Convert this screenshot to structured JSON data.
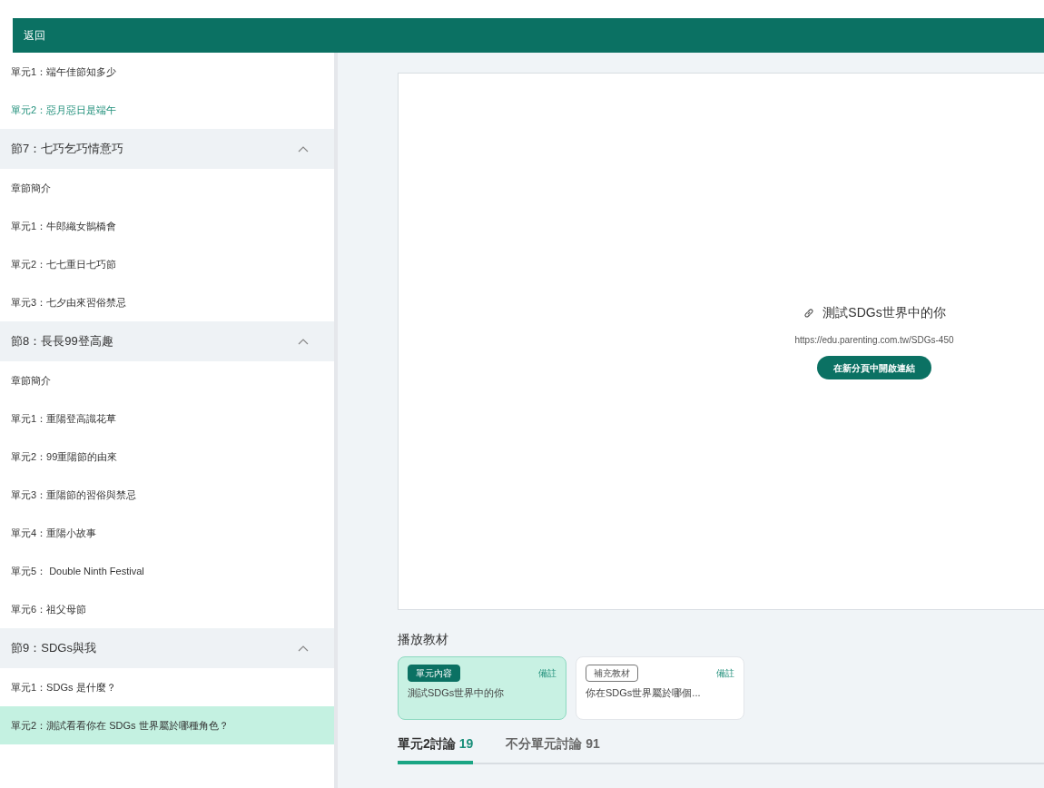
{
  "header": {
    "back": "返回"
  },
  "sidebar": {
    "items": [
      {
        "kind": "unit",
        "label": "單元1：端午佳節知多少",
        "visited": false,
        "selected": false
      },
      {
        "kind": "unit",
        "label": "單元2：惡月惡日是端午",
        "visited": true,
        "selected": false
      },
      {
        "kind": "section",
        "label": "節7：七巧乞巧情意巧",
        "expanded": true
      },
      {
        "kind": "unit",
        "label": "章節簡介",
        "visited": false,
        "selected": false
      },
      {
        "kind": "unit",
        "label": "單元1：牛郎織女鵲橋會",
        "visited": false,
        "selected": false
      },
      {
        "kind": "unit",
        "label": "單元2：七七重日七巧節",
        "visited": false,
        "selected": false
      },
      {
        "kind": "unit",
        "label": "單元3：七夕由來習俗禁忌",
        "visited": false,
        "selected": false
      },
      {
        "kind": "section",
        "label": "節8：長長99登高趣",
        "expanded": true
      },
      {
        "kind": "unit",
        "label": "章節簡介",
        "visited": false,
        "selected": false
      },
      {
        "kind": "unit",
        "label": "單元1：重陽登高識花草",
        "visited": false,
        "selected": false
      },
      {
        "kind": "unit",
        "label": "單元2：99重陽節的由來",
        "visited": false,
        "selected": false
      },
      {
        "kind": "unit",
        "label": "單元3：重陽節的習俗與禁忌",
        "visited": false,
        "selected": false
      },
      {
        "kind": "unit",
        "label": "單元4：重陽小故事",
        "visited": false,
        "selected": false
      },
      {
        "kind": "unit",
        "label": "單元5： Double Ninth Festival",
        "visited": false,
        "selected": false
      },
      {
        "kind": "unit",
        "label": "單元6：祖父母節",
        "visited": false,
        "selected": false
      },
      {
        "kind": "section",
        "label": "節9：SDGs與我",
        "expanded": true
      },
      {
        "kind": "unit",
        "label": "單元1：SDGs 是什麼？",
        "visited": false,
        "selected": false
      },
      {
        "kind": "unit",
        "label": "單元2：測試看看你在 SDGs 世界屬於哪種角色？",
        "visited": false,
        "selected": true
      }
    ]
  },
  "viewer": {
    "title": "測試SDGs世界中的你",
    "url": "https://edu.parenting.com.tw/SDGs-450",
    "button": "在新分頁中開啟連結"
  },
  "materials": {
    "heading": "播放教材",
    "items": [
      {
        "kind": "filled",
        "badge": "單元內容",
        "note": "備註",
        "title": "測試SDGs世界中的你",
        "selected": true
      },
      {
        "kind": "outline",
        "badge": "補充教材",
        "note": "備註",
        "title": "你在SDGs世界屬於哪個...",
        "selected": false
      }
    ]
  },
  "discussion_tabs": [
    {
      "label": "單元2討論",
      "count": "19",
      "selected": true
    },
    {
      "label": "不分單元討論",
      "count": "91",
      "selected": false
    }
  ]
}
